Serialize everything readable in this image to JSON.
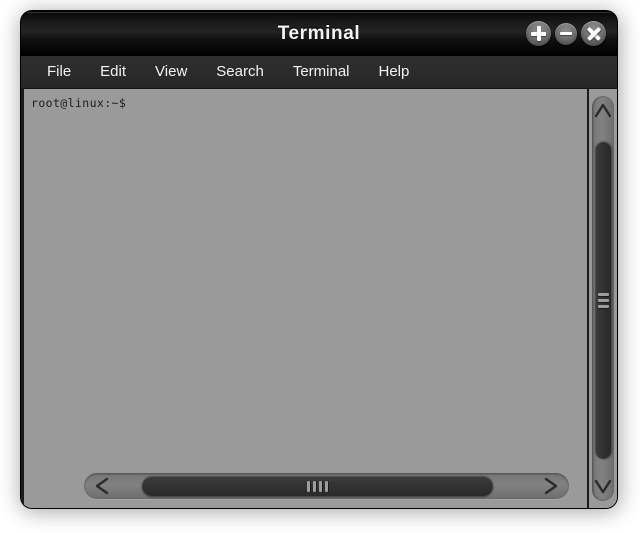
{
  "window": {
    "title": "Terminal",
    "controls": [
      {
        "name": "maximize-button",
        "icon": "plus-icon",
        "label": "+"
      },
      {
        "name": "minimize-button",
        "icon": "minus-icon",
        "label": "−"
      },
      {
        "name": "close-button",
        "icon": "close-icon",
        "label": "×"
      }
    ]
  },
  "menu": {
    "items": [
      {
        "label": "File"
      },
      {
        "label": "Edit"
      },
      {
        "label": "View"
      },
      {
        "label": "Search"
      },
      {
        "label": "Terminal"
      },
      {
        "label": "Help"
      }
    ]
  },
  "terminal": {
    "prompt": "root@linux:~$",
    "lines": [
      "root@linux:~$"
    ],
    "background_color": "#9a9a9a",
    "text_color": "#1d1d1d"
  },
  "scrollbars": {
    "vertical": {
      "up_arrow_icon": "chevron-up-icon",
      "down_arrow_icon": "chevron-down-icon",
      "grip_icon": "grip-horizontal-icon"
    },
    "horizontal": {
      "left_arrow_icon": "chevron-left-icon",
      "right_arrow_icon": "chevron-right-icon",
      "grip_icon": "grip-vertical-icon"
    }
  },
  "theme": {
    "titlebar_color": "#121212",
    "menubar_color": "#2b2b2b",
    "frame_color": "#0a0a0a",
    "content_color": "#9a9a9a",
    "desktop_color": "#ffffff"
  }
}
